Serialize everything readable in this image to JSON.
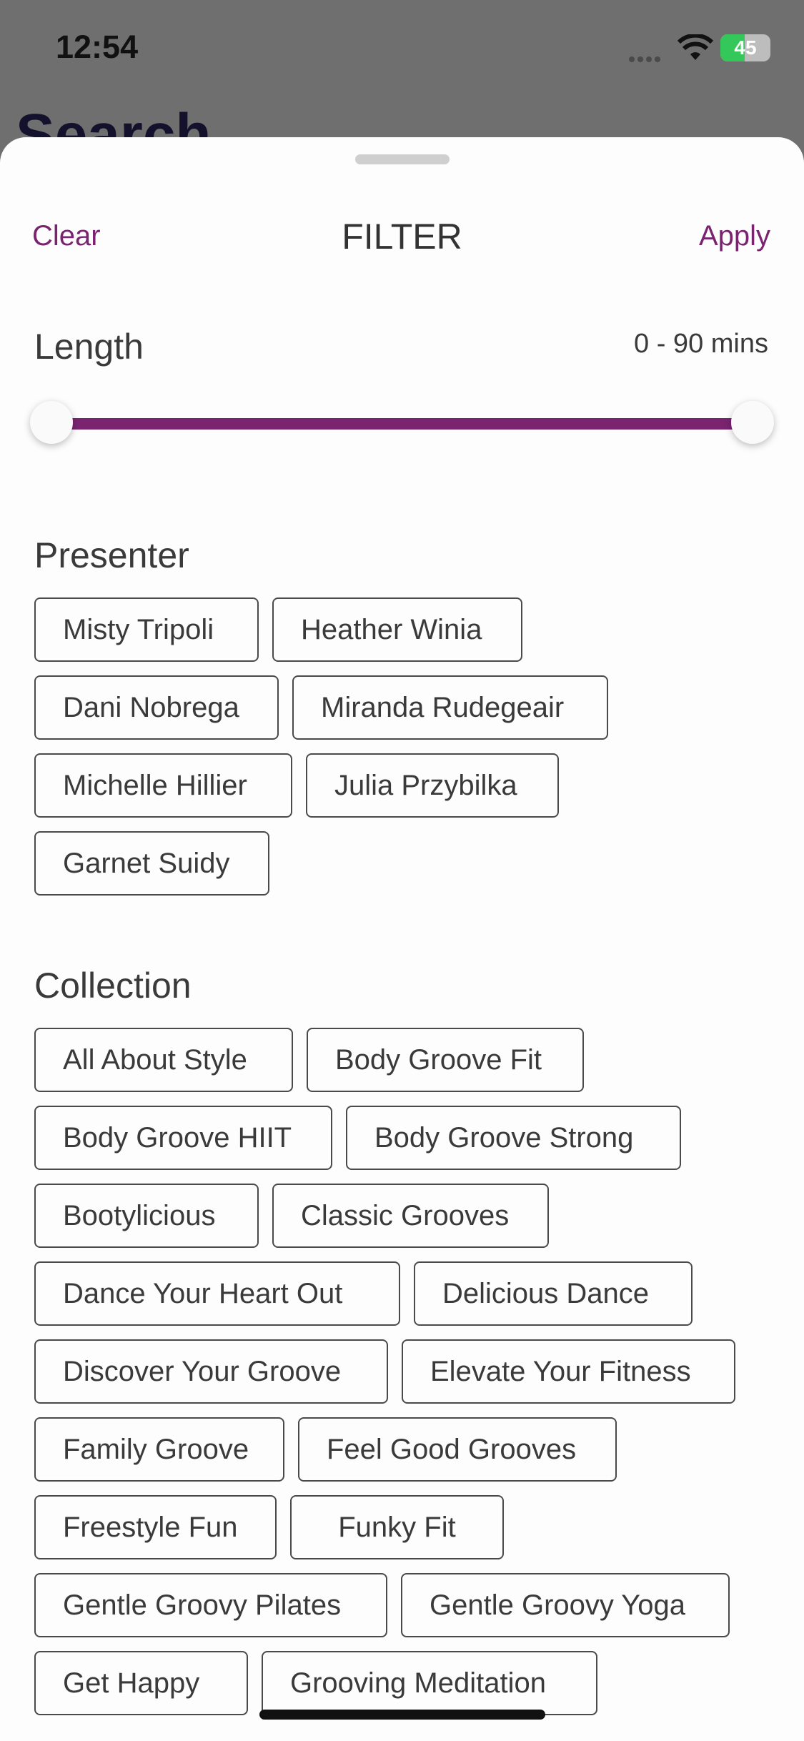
{
  "status": {
    "time": "12:54",
    "battery": "45"
  },
  "background": {
    "title": "Search"
  },
  "header": {
    "clear": "Clear",
    "title": "FILTER",
    "apply": "Apply"
  },
  "length": {
    "label": "Length",
    "value": "0 - 90 mins",
    "min": 0,
    "max": 90,
    "low": 0,
    "high": 90
  },
  "presenter": {
    "label": "Presenter",
    "rows": [
      [
        "Misty Tripoli",
        "Heather Winia"
      ],
      [
        "Dani Nobrega",
        "Miranda Rudegeair"
      ],
      [
        "Michelle Hillier",
        "Julia Przybilka"
      ],
      [
        "Garnet Suidy"
      ]
    ]
  },
  "collection": {
    "label": "Collection",
    "rows": [
      [
        "All About Style",
        "Body Groove Fit"
      ],
      [
        "Body Groove HIIT",
        "Body Groove Strong"
      ],
      [
        "Bootylicious",
        "Classic Grooves"
      ],
      [
        "Dance Your Heart Out",
        "Delicious Dance"
      ],
      [
        "Discover Your Groove",
        "Elevate Your Fitness"
      ],
      [
        "Family Groove",
        "Feel Good Grooves"
      ],
      [
        "Freestyle Fun",
        "Funky Fit"
      ],
      [
        "Gentle Groovy Pilates",
        "Gentle Groovy Yoga"
      ],
      [
        "Get Happy",
        "Grooving Meditation"
      ]
    ]
  },
  "colors": {
    "accent": "#7a2470",
    "text": "#3a3a3a",
    "chip_border": "#4a4a4a"
  }
}
